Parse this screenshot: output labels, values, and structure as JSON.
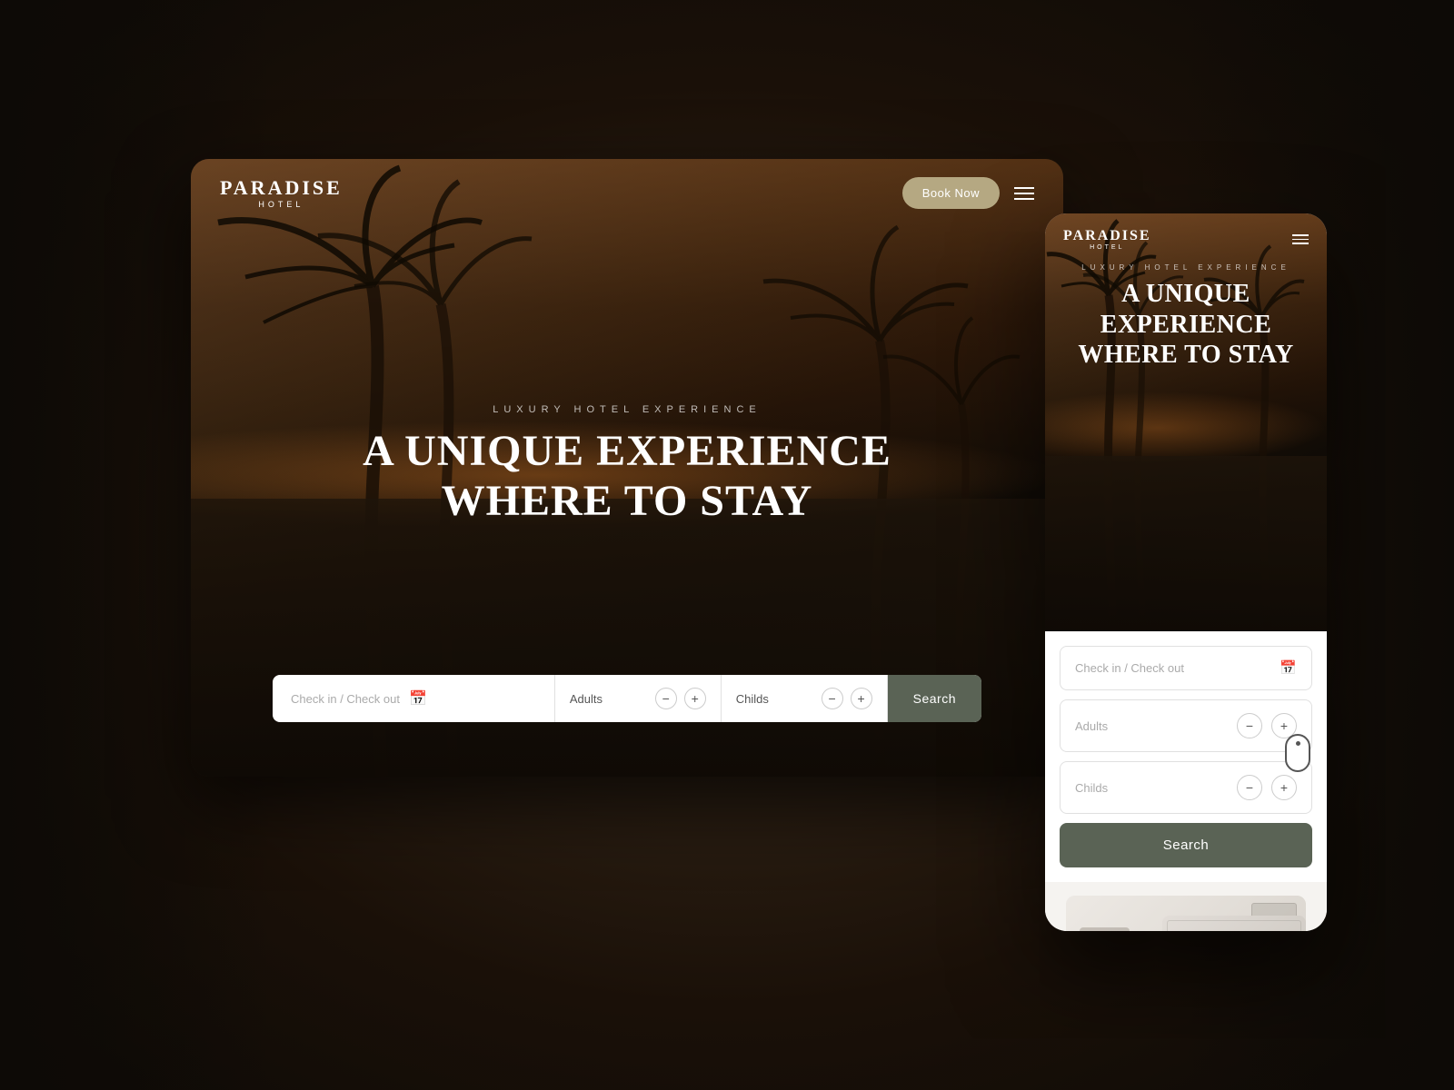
{
  "background": {
    "color": "#1a1410"
  },
  "desktop": {
    "nav": {
      "logo_name": "PARADISE",
      "logo_sub": "HOTEL",
      "book_now_label": "Book Now"
    },
    "hero": {
      "luxury_label": "LUXURY HOTEL EXPERIENCE",
      "title_line1": "A UNIQUE EXPERIENCE",
      "title_line2": "WHERE TO STAY"
    },
    "search_bar": {
      "checkin_placeholder": "Check in / Check out",
      "adults_label": "Adults",
      "childs_label": "Childs",
      "search_label": "Search"
    }
  },
  "mobile": {
    "nav": {
      "logo_name": "PARADISE",
      "logo_sub": "HOTEL"
    },
    "hero": {
      "luxury_label": "LUXURY HOTEL EXPERIENCE",
      "title_line1": "A UNIQUE",
      "title_line2": "EXPERIENCE",
      "title_line3": "WHERE TO STAY"
    },
    "search": {
      "checkin_placeholder": "Check in / Check out",
      "adults_label": "Adults",
      "childs_label": "Childs",
      "search_label": "Search"
    }
  }
}
